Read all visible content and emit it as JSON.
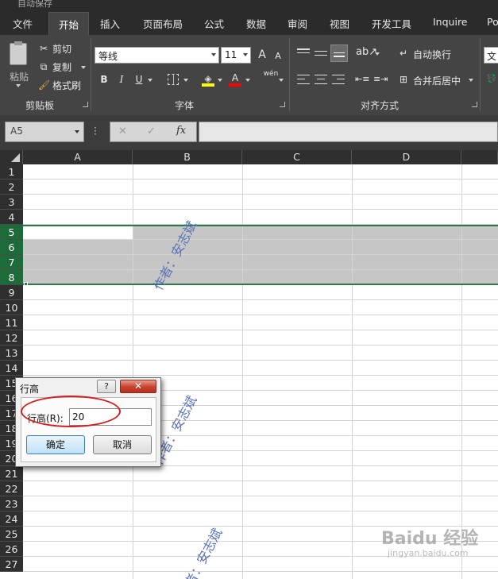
{
  "titlebar": {
    "text": "自动保存"
  },
  "tabs": [
    "文件",
    "开始",
    "插入",
    "页面布局",
    "公式",
    "数据",
    "审阅",
    "视图",
    "开发工具",
    "Inquire",
    "Po"
  ],
  "active_tab": "开始",
  "clipboard": {
    "paste": "粘贴",
    "cut": "剪切",
    "copy": "复制",
    "format_painter": "格式刷",
    "label": "剪贴板"
  },
  "font": {
    "name": "等线",
    "size": "11",
    "grow": "A",
    "shrink": "A",
    "bold": "B",
    "italic": "I",
    "underline": "U",
    "font_color": "A",
    "phonetic": "wén",
    "label": "字体"
  },
  "alignment": {
    "wrap_text": "自动换行",
    "merge_center": "合并后居中",
    "label": "对齐方式"
  },
  "number": {
    "format_partial": "文"
  },
  "formula_bar": {
    "name_box": "A5",
    "cancel": "✕",
    "enter": "✓",
    "fx": "fx",
    "formula": ""
  },
  "columns": [
    "A",
    "B",
    "C",
    "D"
  ],
  "rows": [
    "1",
    "2",
    "3",
    "4",
    "5",
    "6",
    "7",
    "8",
    "9",
    "10",
    "11",
    "12",
    "13",
    "14",
    "15",
    "16",
    "17",
    "18",
    "19",
    "20",
    "21",
    "22",
    "23",
    "24",
    "25",
    "26",
    "27"
  ],
  "selected_rows": [
    "5",
    "6",
    "7",
    "8"
  ],
  "watermark": "作者：安志斌",
  "dialog": {
    "title": "行高",
    "help": "?",
    "close": "✕",
    "label": "行高(R):",
    "value": "20",
    "ok": "确定",
    "cancel": "取消"
  },
  "brand": {
    "logo": "Baidu 经验",
    "url": "jingyan.baidu.com"
  },
  "colors": {
    "ribbon": "#444444",
    "selection_header": "#1e6b3a",
    "selected_fill": "#c6c6c6",
    "annotation": "#d02020"
  }
}
